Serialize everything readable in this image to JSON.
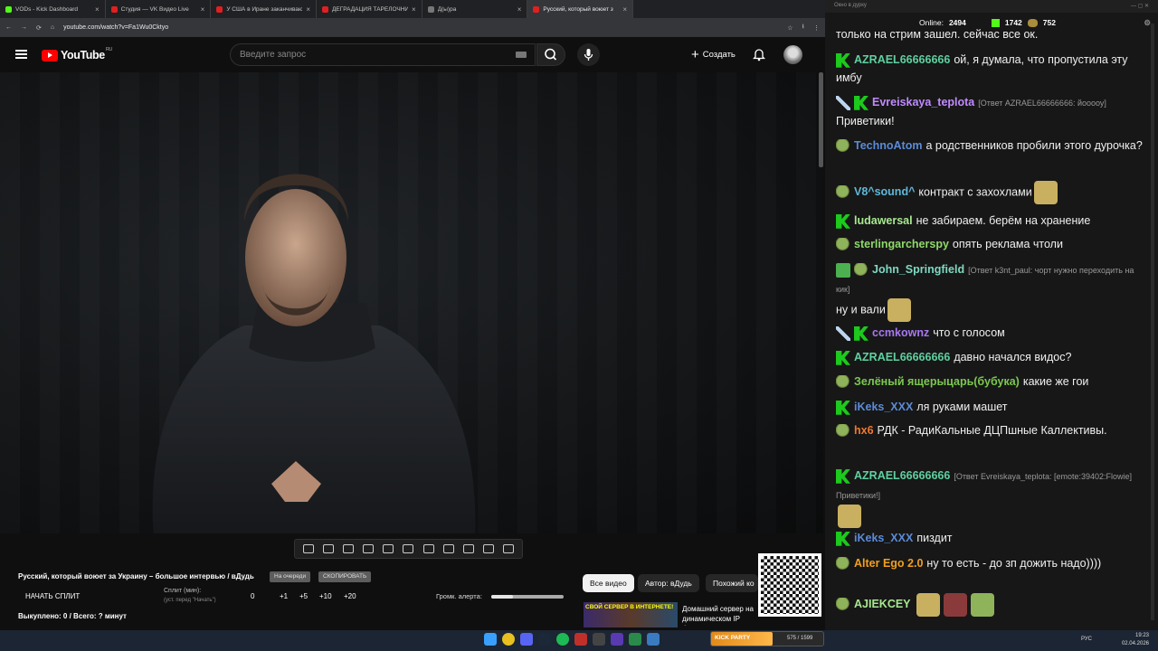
{
  "browser": {
    "tabs": [
      {
        "title": "VODs - Kick Dashboard",
        "color": "#53fc18",
        "active": false
      },
      {
        "title": "Студия — VK Видео Live",
        "color": "#e02020",
        "active": false
      },
      {
        "title": "У США в Иране заканчиваютс",
        "color": "#e02020",
        "active": false
      },
      {
        "title": "ДЕГРАДАЦИЯ ТАРЕЛОЧНИЦ",
        "color": "#e02020",
        "active": false
      },
      {
        "title": "Д(ы)ра",
        "color": "#777777",
        "active": false
      },
      {
        "title": "Русский, который воюет з",
        "color": "#e02020",
        "active": true
      }
    ],
    "url": "youtube.com/watch?v=Fa1Wu0Cktyo"
  },
  "youtube": {
    "logo_text": "YouTube",
    "logo_region": "RU",
    "search_placeholder": "Введите запрос",
    "create_label": "Создать"
  },
  "controls": {
    "video_title": "Русский, который воюет за Украину – большое интервью / вДудь",
    "pill_1": "На очереди",
    "pill_2": "СКОПИРОВАТЬ",
    "start_split": "НАЧАТЬ СПЛИТ",
    "split_label": "Сплит (мин):",
    "split_hint": "(уст. перед \"Начать\")",
    "split_value": "0",
    "split_buttons": [
      "+1",
      "+5",
      "+10",
      "+20"
    ],
    "volume_label": "Громк. алерта:",
    "volume_level": 0.3,
    "bought": "Выкуплено: 0 / Всего: ? минут"
  },
  "related": {
    "chips": [
      {
        "label": "Все видео",
        "selected": true
      },
      {
        "label": "Автор: вДудь",
        "selected": false
      },
      {
        "label": "Похожий ко",
        "selected": false
      }
    ],
    "ad_banner": "СВОЙ СЕРВЕР В ИНТЕРНЕТЕ!",
    "ad_text": "Домашний сервер на динамическом IP бесплатно!"
  },
  "chat_panel": {
    "window_title": "Окно в дурку",
    "online_label": "Online:",
    "online_count": "2494",
    "kick_count": "1742",
    "coin_count": "752",
    "messages": [
      {
        "badges": [],
        "name": "",
        "name_color": "#ffffff",
        "text": "только на стрим зашел. сейчас все ок.",
        "reply": "",
        "emotes": 0
      },
      {
        "badges": [
          "kick"
        ],
        "name": "AZRAEL66666666",
        "name_color": "#5fd0a0",
        "text": "ой, я думала, что пропустила эту имбу",
        "reply": "",
        "emotes": 0
      },
      {
        "badges": [
          "sword",
          "kick"
        ],
        "name": "Evreiskaya_teplota",
        "name_color": "#c08bff",
        "text": "Приветики!",
        "reply": "[Ответ AZRAEL66666666: йооооу]",
        "emotes": 0
      },
      {
        "badges": [
          "pepe"
        ],
        "name": "TechnoAtom",
        "name_color": "#5b8bd8",
        "text": "а родственников пробили этого дурочка?",
        "reply": "",
        "emotes": 0
      },
      {
        "badges": [
          "pepe"
        ],
        "name": "V8^sound^",
        "name_color": "#5fb8d8",
        "text": "контракт с захохлами",
        "reply": "",
        "emotes": 1
      },
      {
        "badges": [
          "kick"
        ],
        "name": "ludawersal",
        "name_color": "#a8e890",
        "text": "не забираем. берём на хранение",
        "reply": "",
        "emotes": 0
      },
      {
        "badges": [
          "pepe"
        ],
        "name": "sterlingarcherspy",
        "name_color": "#8fd86a",
        "text": "опять реклама чтоли",
        "reply": "",
        "emotes": 0
      },
      {
        "badges": [
          "pen",
          "pepe"
        ],
        "name": "John_Springfield",
        "name_color": "#7fd8c0",
        "text": "ну и вали",
        "reply": "[Ответ k3nt_paul: чорт нужно переходить на кик]",
        "emotes": 1
      },
      {
        "badges": [
          "sword",
          "kick"
        ],
        "name": "ccmkownz",
        "name_color": "#a878f0",
        "text": "что с голосом",
        "reply": "",
        "emotes": 0
      },
      {
        "badges": [
          "kick"
        ],
        "name": "AZRAEL66666666",
        "name_color": "#5fd0a0",
        "text": "давно начался видос?",
        "reply": "",
        "emotes": 0
      },
      {
        "badges": [
          "pepe"
        ],
        "name": "Зелёный ящерыцарь(бубука)",
        "name_color": "#7cc850",
        "text": "какие же гои",
        "reply": "",
        "emotes": 0
      },
      {
        "badges": [
          "kick"
        ],
        "name": "iKeks_XXX",
        "name_color": "#5b8bd8",
        "text": "ля руками машет",
        "reply": "",
        "emotes": 0
      },
      {
        "badges": [
          "pepe"
        ],
        "name": "hx6",
        "name_color": "#f07830",
        "text": "РДК - РадиКальные ДЦПшные Каллективы.",
        "reply": "",
        "emotes": 0
      },
      {
        "badges": [
          "kick"
        ],
        "name": "AZRAEL66666666",
        "name_color": "#5fd0a0",
        "text": "",
        "reply": "[Ответ Evreiskaya_teplota: [emote:39402:Flowie] Приветики!]",
        "emotes": 1
      },
      {
        "badges": [
          "kick"
        ],
        "name": "iKeks_XXX",
        "name_color": "#5b8bd8",
        "text": "пиздит",
        "reply": "",
        "emotes": 0
      },
      {
        "badges": [
          "pepe"
        ],
        "name": "Alter Ego 2.0",
        "name_color": "#f0a020",
        "text": "ну то есть - до зп дожить надо))))",
        "reply": "",
        "emotes": 0
      },
      {
        "badges": [
          "pepe"
        ],
        "name": "AJIEKCEY",
        "name_color": "#a8e890",
        "text": "",
        "reply": "",
        "emotes": 3
      }
    ]
  },
  "taskbar": {
    "kick_bar_label": "KICK PARTY",
    "kick_bar_progress": "575 / 1599",
    "lang": "РУС",
    "time": "19:23",
    "date": "02.04.2026"
  }
}
